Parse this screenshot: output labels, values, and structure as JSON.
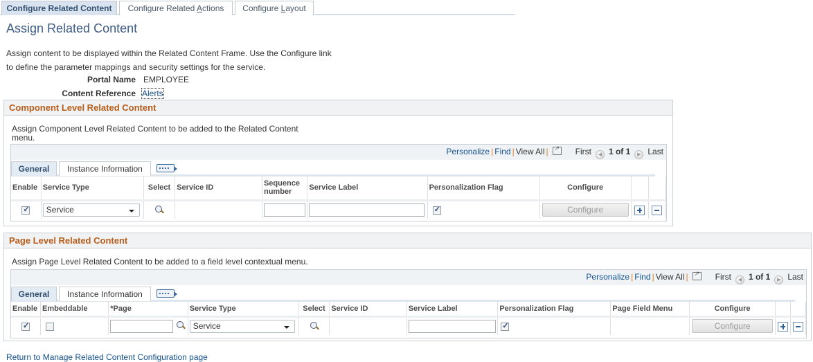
{
  "tabs": [
    {
      "label": "Configure Related Content",
      "active": true
    },
    {
      "label_pre": "Configure Related ",
      "label_key": "A",
      "label_post": "ctions",
      "active": false
    },
    {
      "label_pre": "Configure ",
      "label_key": "L",
      "label_post": "ayout",
      "active": false
    }
  ],
  "page_title": "Assign Related Content",
  "intro_text": "Assign content to be displayed within the Related Content Frame. Use the Configure link to define the parameter mappings and security settings for the service.",
  "portal_name_label": "Portal Name",
  "portal_name_value": "EMPLOYEE",
  "content_reference_label": "Content Reference",
  "content_reference_value": "Alerts",
  "component_section": {
    "title": "Component Level Related Content",
    "description": "Assign Component Level Related Content to be added to the Related Content menu.",
    "nav": {
      "personalize": "Personalize",
      "find": "Find",
      "view_all": "View All",
      "first": "First",
      "count": "1 of 1",
      "last": "Last"
    },
    "grid_tabs": [
      "General",
      "Instance Information"
    ],
    "columns": [
      "Enable",
      "Service Type",
      "Select",
      "Service ID",
      "Sequence number",
      "Service Label",
      "Personalization Flag",
      "Configure"
    ],
    "rows": [
      {
        "enable": true,
        "service_type": "Service",
        "service_id": "",
        "sequence": "",
        "service_label": "",
        "personalization_flag": true,
        "configure_label": "Configure"
      }
    ]
  },
  "page_section": {
    "title": "Page Level Related Content",
    "description": "Assign Page Level Related Content to be added to a field level contextual menu.",
    "nav": {
      "personalize": "Personalize",
      "find": "Find",
      "view_all": "View All",
      "first": "First",
      "count": "1 of 1",
      "last": "Last"
    },
    "grid_tabs": [
      "General",
      "Instance Information"
    ],
    "columns": [
      "Enable",
      "Embeddable",
      "*Page",
      "Service Type",
      "Select",
      "Service ID",
      "Service Label",
      "Personalization Flag",
      "Page Field Menu",
      "Configure"
    ],
    "rows": [
      {
        "enable": true,
        "embeddable": false,
        "page": "",
        "service_type": "Service",
        "service_id": "",
        "service_label": "",
        "personalization_flag": true,
        "page_field_menu": "",
        "configure_label": "Configure"
      }
    ]
  },
  "return_link": "Return to Manage Related Content Configuration page"
}
